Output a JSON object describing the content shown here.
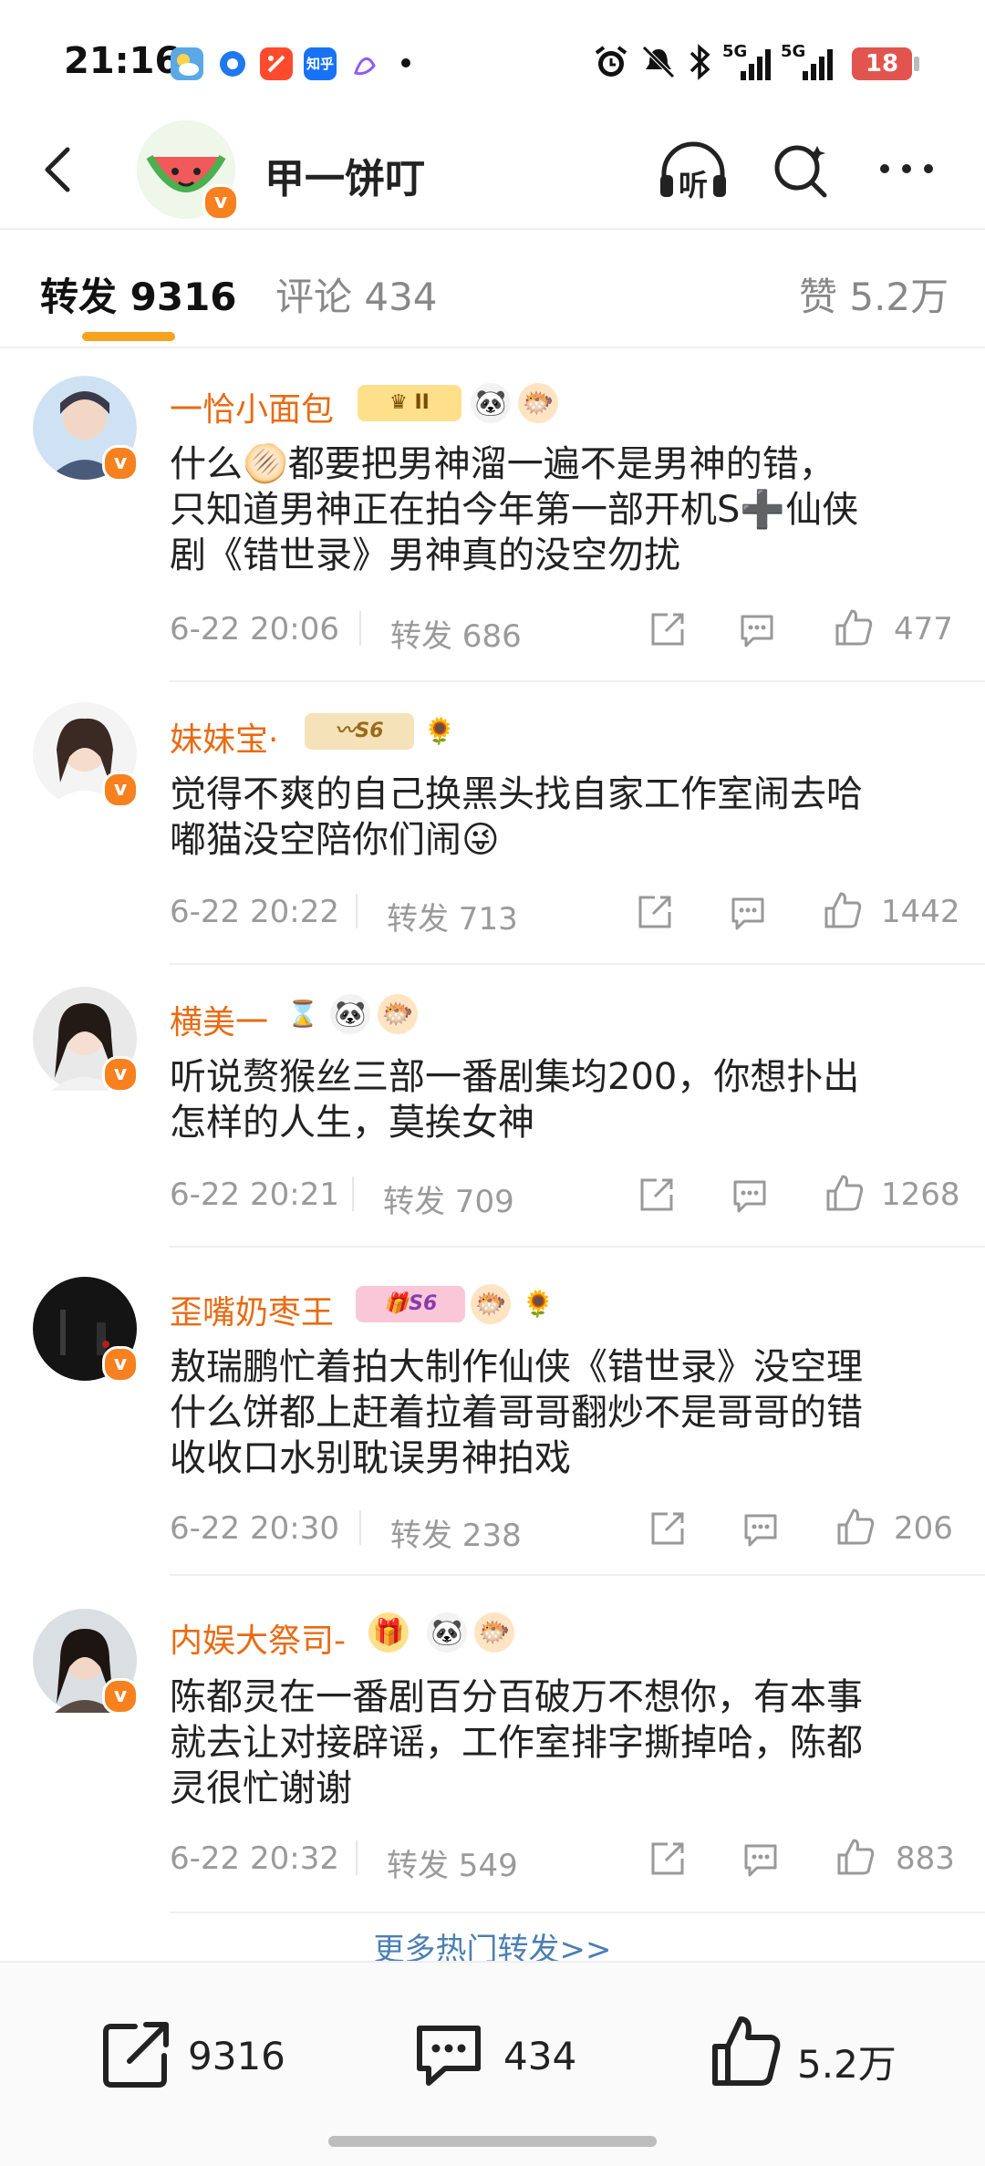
{
  "status_bar": {
    "time": "21:16",
    "app_icons": [
      "weather-icon",
      "message-icon",
      "video-icon",
      "zhihu-icon",
      "music-icon"
    ],
    "zhihu_label": "知乎",
    "right_icons": [
      "alarm-icon",
      "mute-icon",
      "bluetooth-icon",
      "signal-5g-icon",
      "signal-5g-2-icon"
    ],
    "net1": "5G",
    "net2": "5G",
    "battery": "18"
  },
  "header": {
    "title": "甲一饼叮",
    "listen_label": "听",
    "icons": [
      "back-icon",
      "listen-icon",
      "search-icon",
      "more-icon"
    ]
  },
  "tabs": {
    "reposts": "转发 9316",
    "comments": "评论 434",
    "likes": "赞 5.2万"
  },
  "comments": [
    {
      "name": "一恰小面包",
      "text_lines": [
        "什么🫓都要把男神溜一遍不是男神的错，",
        "只知道男神正在拍今年第一部开机S➕仙侠",
        "剧《错世录》男神真的没空勿扰"
      ],
      "time": "6-22 20:06",
      "repost": "转发 686",
      "likes": "477",
      "badges": [
        "crown-level-II",
        "panda",
        "fish"
      ],
      "level_label": "II"
    },
    {
      "name": "妹妹宝·",
      "text_lines": [
        "觉得不爽的自己换黑头找自家工作室闹去哈",
        "嘟猫没空陪你们闹😜"
      ],
      "time": "6-22 20:22",
      "repost": "转发 713",
      "likes": "1442",
      "badges": [
        "s6-wings",
        "sunflower"
      ],
      "level_label": "S6"
    },
    {
      "name": "横美一",
      "text_lines": [
        "听说赘猴丝三部一番剧集均200，你想扑出",
        "怎样的人生，莫挨女神"
      ],
      "time": "6-22 20:21",
      "repost": "转发 709",
      "likes": "1268",
      "badges": [
        "hourglass",
        "panda",
        "fish"
      ]
    },
    {
      "name": "歪嘴奶枣王",
      "text_lines": [
        "敖瑞鹏忙着拍大制作仙侠《错世录》没空理",
        "什么饼都上赶着拉着哥哥翻炒不是哥哥的错",
        "收收口水别耽误男神拍戏"
      ],
      "time": "6-22 20:30",
      "repost": "转发 238",
      "likes": "206",
      "badges": [
        "s6-gift",
        "fish",
        "sunflower"
      ],
      "level_label": "S6"
    },
    {
      "name": "内娱大祭司-",
      "text_lines": [
        "陈都灵在一番剧百分百破万不想你，有本事",
        "就去让对接辟谣，工作室排字撕掉哈，陈都",
        "灵很忙谢谢"
      ],
      "time": "6-22 20:32",
      "repost": "转发 549",
      "likes": "883",
      "badges": [
        "gift-box",
        "panda",
        "fish"
      ]
    }
  ],
  "more_link": "更多热门转发>>",
  "bottom_bar": {
    "repost_count": "9316",
    "comment_count": "434",
    "like_count": "5.2万"
  },
  "colors": {
    "accent": "#f7a21f",
    "name_orange": "#e86b13",
    "verified": "#f7801f",
    "link_blue": "#4b7fb3"
  }
}
